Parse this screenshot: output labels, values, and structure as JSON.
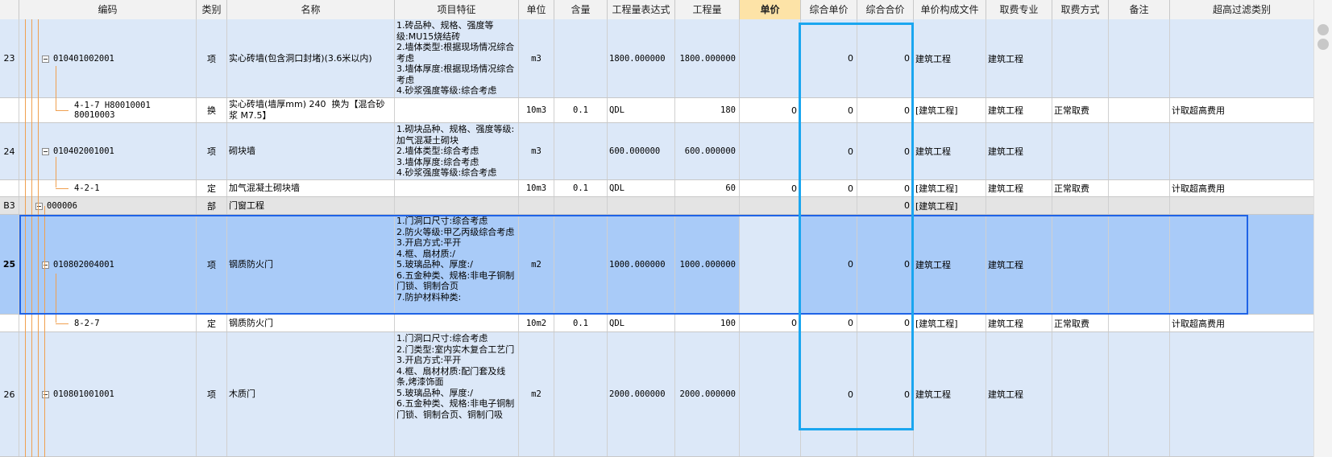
{
  "columns": [
    "",
    "编码",
    "类别",
    "名称",
    "项目特征",
    "单位",
    "含量",
    "工程量表达式",
    "工程量",
    "单价",
    "综合单价",
    "综合合价",
    "单价构成文件",
    "取费专业",
    "取费方式",
    "备注",
    "超高过滤类别"
  ],
  "highlight_column": "单价",
  "rows": [
    {
      "num": "23",
      "code": "010401002001",
      "type": "项",
      "name": "实心砖墙(包含洞口封堵)(3.6米以内)",
      "feature": "1.砖品种、规格、强度等级:MU15烧结砖\n2.墙体类型:根据现场情况综合考虑\n3.墙体厚度:根据现场情况综合考虑\n4.砂浆强度等级:综合考虑",
      "unit": "m3",
      "content": "",
      "expr": "1800.000000",
      "qty": "1800.000000",
      "price": "",
      "unit_total": "0",
      "total": "0",
      "file": "建筑工程",
      "major": "建筑工程",
      "fee": "",
      "note": "",
      "filter": ""
    },
    {
      "num": "",
      "code": "4-1-7 H80010001 80010003",
      "type": "换",
      "name": "实心砖墙(墙厚mm) 240  换为【混合砂浆 M7.5】",
      "feature": "",
      "unit": "10m3",
      "content": "0.1",
      "expr": "QDL",
      "qty": "180",
      "price": "0",
      "unit_total": "0",
      "total": "0",
      "file": "[建筑工程]",
      "major": "建筑工程",
      "fee": "正常取费",
      "note": "",
      "filter": "计取超高费用"
    },
    {
      "num": "24",
      "code": "010402001001",
      "type": "项",
      "name": "砌块墙",
      "feature": "1.砌块品种、规格、强度等级:加气混凝土砌块\n2.墙体类型:综合考虑\n3.墙体厚度:综合考虑\n4.砂浆强度等级:综合考虑",
      "unit": "m3",
      "content": "",
      "expr": "600.000000",
      "qty": "600.000000",
      "price": "",
      "unit_total": "0",
      "total": "0",
      "file": "建筑工程",
      "major": "建筑工程",
      "fee": "",
      "note": "",
      "filter": ""
    },
    {
      "num": "",
      "code": "4-2-1",
      "type": "定",
      "name": "加气混凝土砌块墙",
      "feature": "",
      "unit": "10m3",
      "content": "0.1",
      "expr": "QDL",
      "qty": "60",
      "price": "0",
      "unit_total": "0",
      "total": "0",
      "file": "[建筑工程]",
      "major": "建筑工程",
      "fee": "正常取费",
      "note": "",
      "filter": "计取超高费用"
    },
    {
      "num": "B3",
      "code": "000006",
      "type": "部",
      "name": "门窗工程",
      "feature": "",
      "unit": "",
      "content": "",
      "expr": "",
      "qty": "",
      "price": "",
      "unit_total": "",
      "total": "0",
      "file": "[建筑工程]",
      "major": "",
      "fee": "",
      "note": "",
      "filter": ""
    },
    {
      "num": "25",
      "code": "010802004001",
      "type": "项",
      "name": "钢质防火门",
      "feature": "1.门洞口尺寸:综合考虑\n2.防火等级:甲乙丙级综合考虑\n3.开启方式:平开\n4.框、扇材质:/\n5.玻璃品种、厚度:/\n6.五金种类、规格:非电子铜制门锁、铜制合页\n7.防护材料种类:",
      "unit": "m2",
      "content": "",
      "expr": "1000.000000",
      "qty": "1000.000000",
      "price": "",
      "unit_total": "0",
      "total": "0",
      "file": "建筑工程",
      "major": "建筑工程",
      "fee": "",
      "note": "",
      "filter": ""
    },
    {
      "num": "",
      "code": "8-2-7",
      "type": "定",
      "name": "钢质防火门",
      "feature": "",
      "unit": "10m2",
      "content": "0.1",
      "expr": "QDL",
      "qty": "100",
      "price": "0",
      "unit_total": "0",
      "total": "0",
      "file": "[建筑工程]",
      "major": "建筑工程",
      "fee": "正常取费",
      "note": "",
      "filter": "计取超高费用"
    },
    {
      "num": "26",
      "code": "010801001001",
      "type": "项",
      "name": "木质门",
      "feature": "1.门洞口尺寸:综合考虑\n2.门类型:室内实木复合工艺门\n3.开启方式:平开\n4.框、扇材材质:配门套及线条,烤漆饰面\n5.玻璃品种、厚度:/\n6.五金种类、规格:非电子铜制门锁、铜制合页、铜制门吸",
      "unit": "m2",
      "content": "",
      "expr": "2000.000000",
      "qty": "2000.000000",
      "price": "",
      "unit_total": "0",
      "total": "0",
      "file": "建筑工程",
      "major": "建筑工程",
      "fee": "",
      "note": "",
      "filter": ""
    }
  ]
}
